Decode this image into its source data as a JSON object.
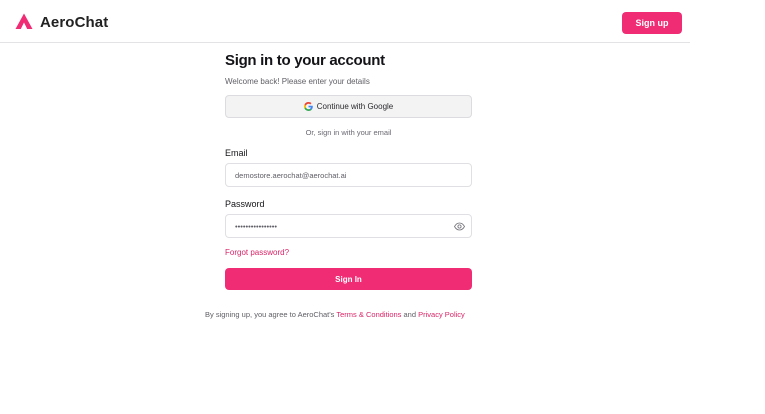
{
  "header": {
    "logo_text": "AeroChat",
    "signup_label": "Sign up"
  },
  "form": {
    "title": "Sign in to your account",
    "subtitle": "Welcome back! Please enter your details",
    "google_label": "Continue with Google",
    "divider_text": "Or, sign in with your email",
    "email_label": "Email",
    "email_value": "demostore.aerochat@aerochat.ai",
    "password_label": "Password",
    "password_value": "••••••••••••••••",
    "forgot_label": "Forgot password?",
    "signin_label": "Sign In"
  },
  "terms": {
    "prefix": "By signing up, you agree to AeroChat's",
    "terms_link": "Terms & Conditions",
    "and": "and",
    "privacy_link": "Privacy Policy"
  },
  "colors": {
    "brand": "#f02c74",
    "link": "#d92467"
  }
}
